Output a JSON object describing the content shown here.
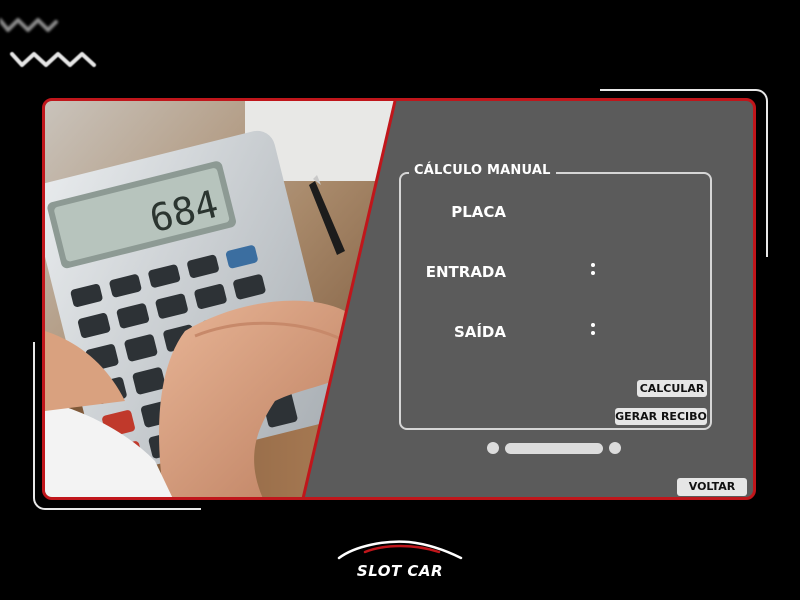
{
  "panel": {
    "title": "CÁLCULO MANUAL",
    "fields": [
      {
        "label": "PLACA",
        "value": "",
        "has_colon": false
      },
      {
        "label": "ENTRADA",
        "value": "",
        "has_colon": true
      },
      {
        "label": "SAÍDA",
        "value": "",
        "has_colon": true
      }
    ],
    "buttons": {
      "calcular": "CALCULAR",
      "gerar_recibo": "GERAR RECIBO"
    }
  },
  "footer": {
    "voltar": "VOLTAR"
  },
  "brand": {
    "name": "SLOT CAR"
  },
  "image": {
    "calculator_display": "684"
  },
  "colors": {
    "accent": "#c0161b",
    "panel_bg": "#5b5b5b",
    "page_bg": "#000000",
    "button_bg": "#e6e6e6"
  }
}
